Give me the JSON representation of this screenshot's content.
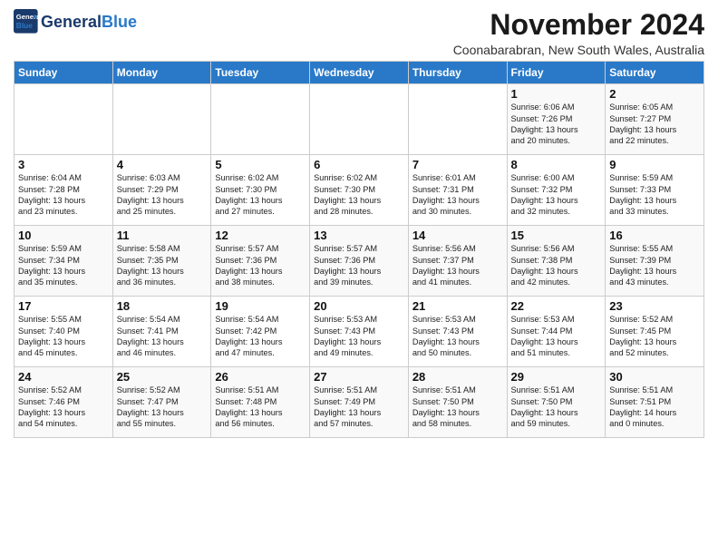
{
  "logo": {
    "text_general": "General",
    "text_blue": "Blue"
  },
  "title": "November 2024",
  "subtitle": "Coonabarabran, New South Wales, Australia",
  "days_of_week": [
    "Sunday",
    "Monday",
    "Tuesday",
    "Wednesday",
    "Thursday",
    "Friday",
    "Saturday"
  ],
  "weeks": [
    [
      {
        "day": "",
        "info": ""
      },
      {
        "day": "",
        "info": ""
      },
      {
        "day": "",
        "info": ""
      },
      {
        "day": "",
        "info": ""
      },
      {
        "day": "",
        "info": ""
      },
      {
        "day": "1",
        "info": "Sunrise: 6:06 AM\nSunset: 7:26 PM\nDaylight: 13 hours\nand 20 minutes."
      },
      {
        "day": "2",
        "info": "Sunrise: 6:05 AM\nSunset: 7:27 PM\nDaylight: 13 hours\nand 22 minutes."
      }
    ],
    [
      {
        "day": "3",
        "info": "Sunrise: 6:04 AM\nSunset: 7:28 PM\nDaylight: 13 hours\nand 23 minutes."
      },
      {
        "day": "4",
        "info": "Sunrise: 6:03 AM\nSunset: 7:29 PM\nDaylight: 13 hours\nand 25 minutes."
      },
      {
        "day": "5",
        "info": "Sunrise: 6:02 AM\nSunset: 7:30 PM\nDaylight: 13 hours\nand 27 minutes."
      },
      {
        "day": "6",
        "info": "Sunrise: 6:02 AM\nSunset: 7:30 PM\nDaylight: 13 hours\nand 28 minutes."
      },
      {
        "day": "7",
        "info": "Sunrise: 6:01 AM\nSunset: 7:31 PM\nDaylight: 13 hours\nand 30 minutes."
      },
      {
        "day": "8",
        "info": "Sunrise: 6:00 AM\nSunset: 7:32 PM\nDaylight: 13 hours\nand 32 minutes."
      },
      {
        "day": "9",
        "info": "Sunrise: 5:59 AM\nSunset: 7:33 PM\nDaylight: 13 hours\nand 33 minutes."
      }
    ],
    [
      {
        "day": "10",
        "info": "Sunrise: 5:59 AM\nSunset: 7:34 PM\nDaylight: 13 hours\nand 35 minutes."
      },
      {
        "day": "11",
        "info": "Sunrise: 5:58 AM\nSunset: 7:35 PM\nDaylight: 13 hours\nand 36 minutes."
      },
      {
        "day": "12",
        "info": "Sunrise: 5:57 AM\nSunset: 7:36 PM\nDaylight: 13 hours\nand 38 minutes."
      },
      {
        "day": "13",
        "info": "Sunrise: 5:57 AM\nSunset: 7:36 PM\nDaylight: 13 hours\nand 39 minutes."
      },
      {
        "day": "14",
        "info": "Sunrise: 5:56 AM\nSunset: 7:37 PM\nDaylight: 13 hours\nand 41 minutes."
      },
      {
        "day": "15",
        "info": "Sunrise: 5:56 AM\nSunset: 7:38 PM\nDaylight: 13 hours\nand 42 minutes."
      },
      {
        "day": "16",
        "info": "Sunrise: 5:55 AM\nSunset: 7:39 PM\nDaylight: 13 hours\nand 43 minutes."
      }
    ],
    [
      {
        "day": "17",
        "info": "Sunrise: 5:55 AM\nSunset: 7:40 PM\nDaylight: 13 hours\nand 45 minutes."
      },
      {
        "day": "18",
        "info": "Sunrise: 5:54 AM\nSunset: 7:41 PM\nDaylight: 13 hours\nand 46 minutes."
      },
      {
        "day": "19",
        "info": "Sunrise: 5:54 AM\nSunset: 7:42 PM\nDaylight: 13 hours\nand 47 minutes."
      },
      {
        "day": "20",
        "info": "Sunrise: 5:53 AM\nSunset: 7:43 PM\nDaylight: 13 hours\nand 49 minutes."
      },
      {
        "day": "21",
        "info": "Sunrise: 5:53 AM\nSunset: 7:43 PM\nDaylight: 13 hours\nand 50 minutes."
      },
      {
        "day": "22",
        "info": "Sunrise: 5:53 AM\nSunset: 7:44 PM\nDaylight: 13 hours\nand 51 minutes."
      },
      {
        "day": "23",
        "info": "Sunrise: 5:52 AM\nSunset: 7:45 PM\nDaylight: 13 hours\nand 52 minutes."
      }
    ],
    [
      {
        "day": "24",
        "info": "Sunrise: 5:52 AM\nSunset: 7:46 PM\nDaylight: 13 hours\nand 54 minutes."
      },
      {
        "day": "25",
        "info": "Sunrise: 5:52 AM\nSunset: 7:47 PM\nDaylight: 13 hours\nand 55 minutes."
      },
      {
        "day": "26",
        "info": "Sunrise: 5:51 AM\nSunset: 7:48 PM\nDaylight: 13 hours\nand 56 minutes."
      },
      {
        "day": "27",
        "info": "Sunrise: 5:51 AM\nSunset: 7:49 PM\nDaylight: 13 hours\nand 57 minutes."
      },
      {
        "day": "28",
        "info": "Sunrise: 5:51 AM\nSunset: 7:50 PM\nDaylight: 13 hours\nand 58 minutes."
      },
      {
        "day": "29",
        "info": "Sunrise: 5:51 AM\nSunset: 7:50 PM\nDaylight: 13 hours\nand 59 minutes."
      },
      {
        "day": "30",
        "info": "Sunrise: 5:51 AM\nSunset: 7:51 PM\nDaylight: 14 hours\nand 0 minutes."
      }
    ]
  ]
}
